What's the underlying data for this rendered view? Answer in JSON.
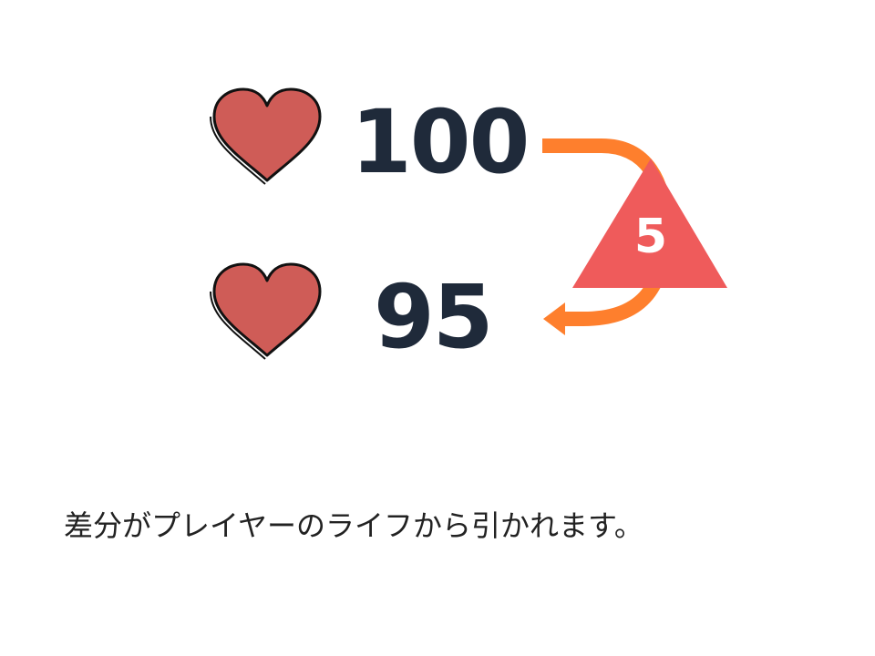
{
  "life": {
    "before": "100",
    "after": "95"
  },
  "difference": {
    "value": "5"
  },
  "caption": "差分がプレイヤーのライフから引かれます。",
  "icons": {
    "life": "heart-icon",
    "flow": "curved-arrow-icon",
    "difference": "triangle-delta-icon"
  },
  "colors": {
    "heart": "#cf5c57",
    "number": "#1f2a3a",
    "arrow": "#fe7f2d",
    "triangle": "#ef5b5b"
  }
}
